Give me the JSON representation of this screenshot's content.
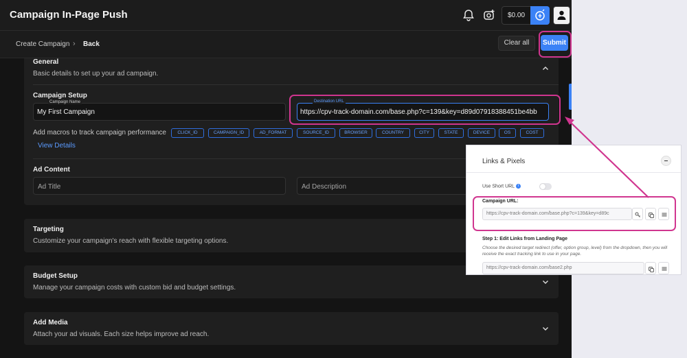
{
  "header": {
    "app_title": "Campaign In-Page Push",
    "balance": "$0.00"
  },
  "breadcrumb": {
    "create": "Create Campaign",
    "separator": "›",
    "back": "Back"
  },
  "actions": {
    "clear_all": "Clear all",
    "submit": "Submit"
  },
  "general": {
    "title": "General",
    "description": "Basic details to set up your ad campaign.",
    "setup_title": "Campaign Setup",
    "campaign_name_label": "Campaign Name",
    "campaign_name_value": "My First Campaign",
    "destination_label": "Destination URL",
    "destination_value": "https://cpv-track-domain.com/base.php?c=139&key=d89d07918388451be4bb",
    "macros_label": "Add macros to track campaign performance",
    "macros": [
      "CLICK_ID",
      "CAMPAIGN_ID",
      "AD_FORMAT",
      "SOURCE_ID",
      "BROWSER",
      "COUNTRY",
      "CITY",
      "STATE",
      "DEVICE",
      "OS",
      "COST"
    ],
    "view_details": "View Details",
    "ad_content_title": "Ad Content",
    "ad_title_placeholder": "Ad Title",
    "ad_description_placeholder": "Ad Description"
  },
  "targeting": {
    "title": "Targeting",
    "description": "Customize your campaign's reach with flexible targeting options."
  },
  "budget": {
    "title": "Budget Setup",
    "description": "Manage your campaign costs with custom bid and budget settings."
  },
  "media": {
    "title": "Add Media",
    "description": "Attach your ad visuals. Each size helps improve ad reach."
  },
  "links_panel": {
    "title": "Links & Pixels",
    "use_short_url": "Use Short URL",
    "info_glyph": "i",
    "campaign_url_label": "Campaign URL:",
    "campaign_url_value": "https://cpv-track-domain.com/base.php?c=139&key=d89c",
    "step1_title": "Step 1: Edit Links from Landing Page",
    "step1_desc": "Choose the desired target redirect (offer, option group, level) from the dropdown, then you will receive the exact tracking link to use in your page.",
    "step1_url": "https://cpv-track-domain.com/base2.php"
  },
  "colors": {
    "accent": "#3b82f6",
    "highlight": "#d0358f",
    "background": "#141414",
    "panel": "#1f1f1f"
  },
  "icons": {
    "bell": "bell-icon",
    "camera_plus": "camera-plus-icon",
    "coin": "coin-icon",
    "user": "user-icon",
    "chevron": "chevron-icon",
    "key": "key-icon",
    "copy": "copy-icon",
    "qr": "qr-icon"
  }
}
